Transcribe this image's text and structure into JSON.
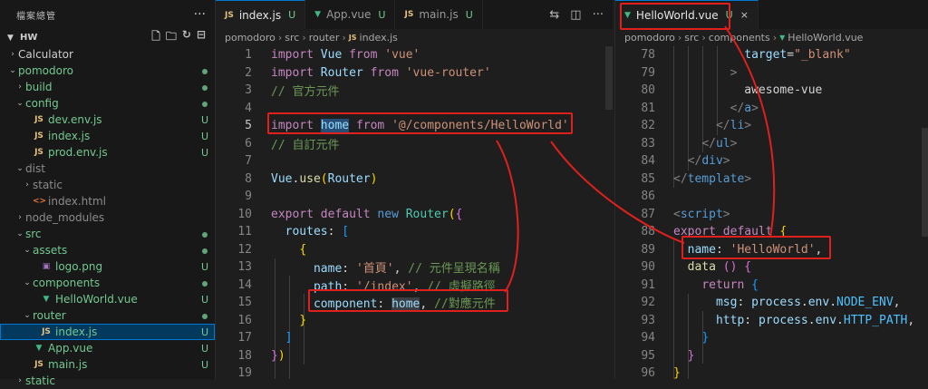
{
  "sidebar": {
    "title": "檔案總管",
    "more": "···",
    "project": "HW",
    "tree": [
      {
        "label": "Calculator",
        "type": "folder",
        "open": false,
        "depth": 1,
        "badge": "",
        "color": "white"
      },
      {
        "label": "pomodoro",
        "type": "folder",
        "open": true,
        "depth": 1,
        "badge": "dot",
        "color": "green"
      },
      {
        "label": "build",
        "type": "folder",
        "open": false,
        "depth": 2,
        "badge": "dot",
        "color": "green"
      },
      {
        "label": "config",
        "type": "folder",
        "open": true,
        "depth": 2,
        "badge": "dot",
        "color": "green"
      },
      {
        "label": "dev.env.js",
        "type": "js",
        "depth": 3,
        "badge": "U",
        "color": "green"
      },
      {
        "label": "index.js",
        "type": "js",
        "depth": 3,
        "badge": "U",
        "color": "green"
      },
      {
        "label": "prod.env.js",
        "type": "js",
        "depth": 3,
        "badge": "U",
        "color": "green"
      },
      {
        "label": "dist",
        "type": "folder",
        "open": true,
        "depth": 2,
        "badge": "",
        "color": "gray"
      },
      {
        "label": "static",
        "type": "folder",
        "open": false,
        "depth": 3,
        "badge": "",
        "color": "gray"
      },
      {
        "label": "index.html",
        "type": "html",
        "depth": 3,
        "badge": "",
        "color": "gray"
      },
      {
        "label": "node_modules",
        "type": "folder",
        "open": false,
        "depth": 2,
        "badge": "",
        "color": "gray"
      },
      {
        "label": "src",
        "type": "folder",
        "open": true,
        "depth": 2,
        "badge": "dot",
        "color": "green"
      },
      {
        "label": "assets",
        "type": "folder",
        "open": true,
        "depth": 3,
        "badge": "dot",
        "color": "green"
      },
      {
        "label": "logo.png",
        "type": "img",
        "depth": 4,
        "badge": "U",
        "color": "green"
      },
      {
        "label": "components",
        "type": "folder",
        "open": true,
        "depth": 3,
        "badge": "dot",
        "color": "green"
      },
      {
        "label": "HelloWorld.vue",
        "type": "vue",
        "depth": 4,
        "badge": "U",
        "color": "green"
      },
      {
        "label": "router",
        "type": "folder",
        "open": true,
        "depth": 3,
        "badge": "dot",
        "color": "green"
      },
      {
        "label": "index.js",
        "type": "js",
        "depth": 4,
        "badge": "U",
        "color": "green",
        "selected": true
      },
      {
        "label": "App.vue",
        "type": "vue",
        "depth": 3,
        "badge": "U",
        "color": "green"
      },
      {
        "label": "main.js",
        "type": "js",
        "depth": 3,
        "badge": "U",
        "color": "green"
      },
      {
        "label": "static",
        "type": "folder",
        "open": false,
        "depth": 2,
        "badge": "",
        "color": "green"
      }
    ]
  },
  "left_editor": {
    "tabs": [
      {
        "icon": "JS",
        "label": "index.js",
        "status": "U",
        "active": true,
        "close": "×"
      },
      {
        "icon": "▼",
        "label": "App.vue",
        "status": "U",
        "active": false
      },
      {
        "icon": "JS",
        "label": "main.js",
        "status": "U",
        "active": false
      }
    ],
    "breadcrumb": [
      "pomodoro",
      "src",
      "router",
      "index.js"
    ],
    "breadcrumb_sep": "›",
    "line_numbers": [
      "1",
      "2",
      "3",
      "4",
      "5",
      "6",
      "7",
      "8",
      "9",
      "10",
      "11",
      "12",
      "13",
      "14",
      "15",
      "16",
      "17",
      "18",
      "19"
    ]
  },
  "right_editor": {
    "tab": {
      "icon": "▼",
      "label": "HelloWorld.vue",
      "status": "U",
      "close": "×"
    },
    "breadcrumb": [
      "pomodoro",
      "src",
      "components",
      "HelloWorld.vue"
    ],
    "line_numbers": [
      "78",
      "79",
      "80",
      "81",
      "82",
      "83",
      "84",
      "85",
      "86",
      "87",
      "88",
      "89",
      "90",
      "91",
      "92",
      "93",
      "94",
      "95",
      "96"
    ]
  },
  "colors": {
    "accent": "#0078d4",
    "annotation": "#e0201c",
    "untracked": "#73c991"
  }
}
